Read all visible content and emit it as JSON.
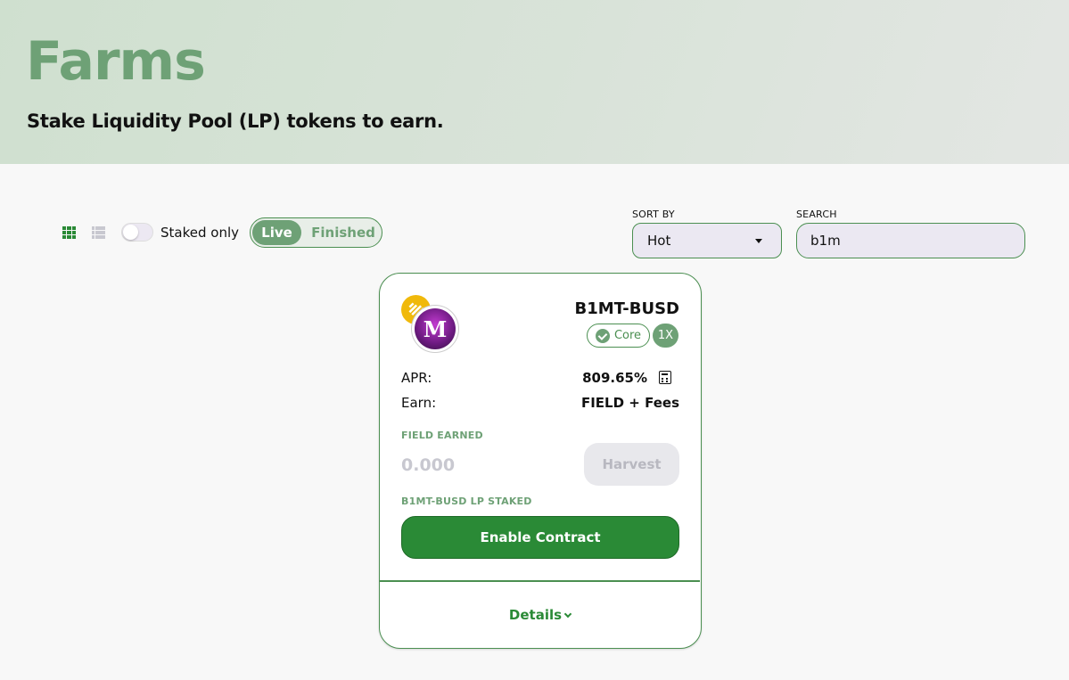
{
  "header": {
    "title": "Farms",
    "subtitle": "Stake Liquidity Pool (LP) tokens to earn."
  },
  "controls": {
    "grid_view_icon": "grid-icon",
    "list_view_icon": "list-icon",
    "staked_only_label": "Staked only",
    "staked_only_on": false,
    "tabs": [
      {
        "label": "Live",
        "active": true
      },
      {
        "label": "Finished",
        "active": false
      }
    ],
    "sort_by": {
      "label": "SORT BY",
      "value": "Hot"
    },
    "search": {
      "label": "SEARCH",
      "value": "b1m"
    }
  },
  "farm_card": {
    "pair": "B1MT-BUSD",
    "core_label": "Core",
    "multiplier": "1X",
    "apr_label": "APR:",
    "apr_value": "809.65%",
    "earn_label": "Earn:",
    "earn_value": "FIELD + Fees",
    "earned_label": "FIELD EARNED",
    "earned_value": "0.000",
    "harvest_label": "Harvest",
    "staked_label": "B1MT-BUSD LP STAKED",
    "enable_label": "Enable Contract",
    "details_label": "Details",
    "token_logo_text": "M"
  },
  "colors": {
    "accent": "#6ea176",
    "primary_button": "#2a8a36",
    "border": "#4b8f51"
  }
}
